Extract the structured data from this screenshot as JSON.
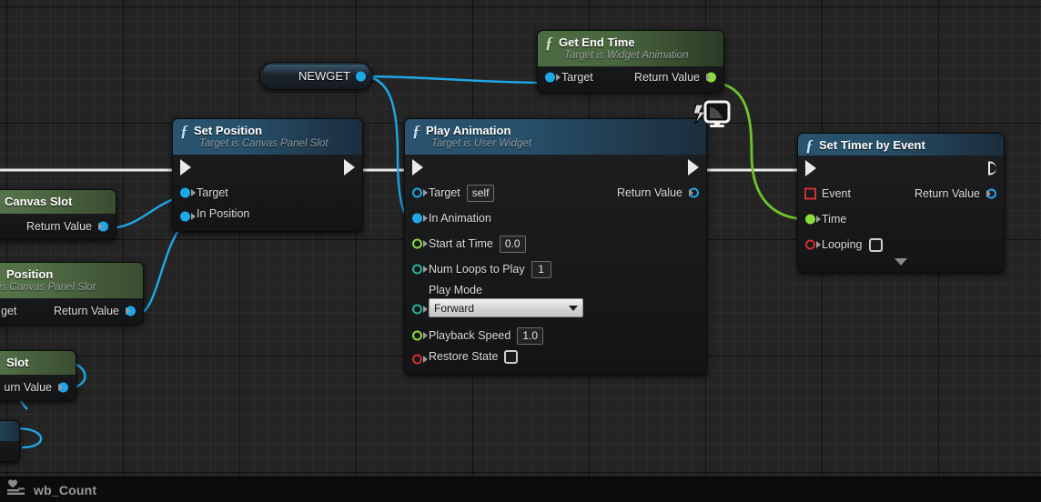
{
  "app": {
    "graph_background": "#242424",
    "accent_blue": "#1fa8e8",
    "accent_green": "#8ddb3a"
  },
  "statusbar": {
    "icon": "widget-blueprint-icon",
    "blueprint_name": "wb_Count"
  },
  "nodes": {
    "get_canvas_slot": {
      "title": "Canvas Slot",
      "outputs": [
        {
          "label": "Return Value",
          "pin": "solid-blue"
        }
      ]
    },
    "get_position": {
      "title": "Position",
      "subtitle": "et is Canvas Panel Slot",
      "inputs": [
        {
          "label": "get"
        }
      ],
      "outputs": [
        {
          "label": "Return Value",
          "pin": "solid-blue"
        }
      ]
    },
    "slot_node": {
      "title": "Slot",
      "outputs": [
        {
          "label": "urn Value",
          "pin": "solid-blue"
        }
      ]
    },
    "newget": {
      "label": "NEWGET",
      "pin": "solid-blue"
    },
    "set_position": {
      "title": "Set Position",
      "subtitle": "Target is Canvas Panel Slot",
      "exec_in": "exec-in",
      "exec_out": "exec-out",
      "inputs": [
        {
          "label": "Target",
          "pin": "solid-blue"
        },
        {
          "label": "In Position",
          "pin": "solid-blue"
        }
      ]
    },
    "get_end_time": {
      "title": "Get End Time",
      "subtitle": "Target is Widget Animation",
      "inputs": [
        {
          "label": "Target",
          "pin": "solid-blue"
        }
      ],
      "outputs": [
        {
          "label": "Return Value",
          "pin": "solid-green"
        }
      ]
    },
    "play_animation": {
      "title": "Play Animation",
      "subtitle": "Target is User Widget",
      "badge": "client-server-replication-icon",
      "inputs": [
        {
          "label": "Target",
          "pin": "hollow-blue",
          "value": "self"
        },
        {
          "label": "In Animation",
          "pin": "solid-blue"
        },
        {
          "label": "Start at Time",
          "pin": "hollow-green",
          "value": "0.0"
        },
        {
          "label": "Num Loops to Play",
          "pin": "hollow-teal",
          "value": "1"
        },
        {
          "label": "Play Mode",
          "pin": "hollow-teal",
          "value": "Forward"
        },
        {
          "label": "Playback Speed",
          "pin": "hollow-green",
          "value": "1.0"
        },
        {
          "label": "Restore State",
          "pin": "hollow-red",
          "value": false
        }
      ],
      "outputs": [
        {
          "label": "Return Value",
          "pin": "hollow-blue"
        }
      ]
    },
    "set_timer_by_event": {
      "title": "Set Timer by Event",
      "inputs": [
        {
          "label": "Event",
          "pin": "square-red"
        },
        {
          "label": "Time",
          "pin": "solid-green"
        },
        {
          "label": "Looping",
          "pin": "hollow-red",
          "value": false
        }
      ],
      "outputs": [
        {
          "label": "Return Value",
          "pin": "hollow-blue"
        }
      ],
      "collapse": "expand-caret"
    }
  }
}
